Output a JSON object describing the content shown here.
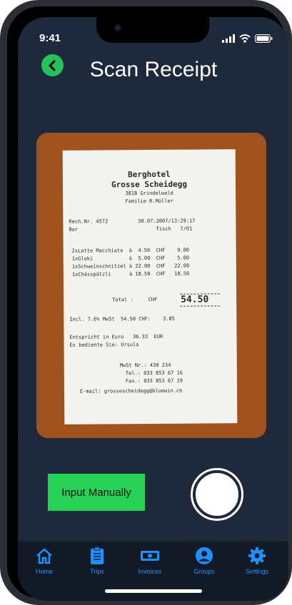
{
  "status": {
    "time": "9:41"
  },
  "header": {
    "title": "Scan Receipt"
  },
  "actions": {
    "input_manually": "Input Manually"
  },
  "receipt": {
    "lines": [
      "Berghotel",
      "Grosse Scheidegg",
      "3818 Grindelwald",
      "Familie R.Müller",
      "Rech.Nr. 4572          30.07.2007/13:29:17",
      "Bar                          Tisch   7/01",
      "2xLatte Macchiato  à  4.50  CHF    9.00",
      "1xGloki            à  5.00  CHF    5.00",
      "1xSchweinschnitzel à 22.00  CHF   22.00",
      "1xChässpätzli      à 18.50  CHF   18.50",
      "Total :     CHF",
      "54.50",
      "Incl. 7.6% MwSt  54.50 CHF:    3.85",
      "Entspricht in Euro   36.33  EUR",
      "Es bediente Sie: Ursula",
      "MwSt Nr.: 430 234",
      "Tel.: 033 853 67 16",
      "Fax.: 033 853 67 19",
      "E-mail: grossescheidegg@bluewin.ch"
    ]
  },
  "tabs": [
    {
      "label": "Home",
      "icon": "home-icon"
    },
    {
      "label": "Trips",
      "icon": "clipboard-icon"
    },
    {
      "label": "Invoices",
      "icon": "money-icon"
    },
    {
      "label": "Groups",
      "icon": "user-circle-icon"
    },
    {
      "label": "Settings",
      "icon": "gear-icon"
    }
  ],
  "colors": {
    "background": "#1e2a3c",
    "accent": "#27d156",
    "tab": "#1e90ff"
  }
}
